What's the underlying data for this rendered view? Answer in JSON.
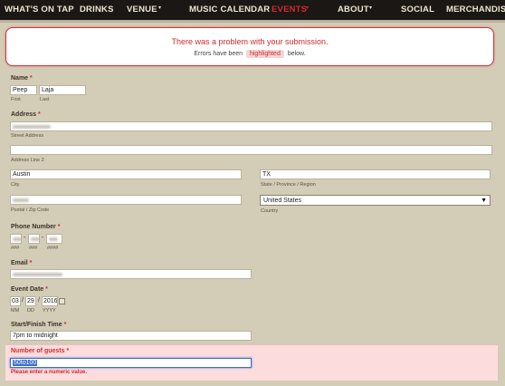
{
  "nav": {
    "items": [
      {
        "label": "What's On Tap",
        "has_menu": false,
        "active": false
      },
      {
        "label": "Drinks",
        "has_menu": false,
        "active": false
      },
      {
        "label": "Venue",
        "has_menu": true,
        "active": false
      },
      {
        "label": "Music Calendar",
        "has_menu": false,
        "active": false
      },
      {
        "label": "Events",
        "has_menu": true,
        "active": true
      },
      {
        "label": "About",
        "has_menu": true,
        "active": false
      },
      {
        "label": "Social",
        "has_menu": false,
        "active": false
      },
      {
        "label": "Merchandise",
        "has_menu": false,
        "active": false
      }
    ],
    "caret": "▾"
  },
  "error_box": {
    "title": "There was a problem with your submission.",
    "line_prefix": "Errors have been",
    "highlight": "highlighted",
    "line_suffix": "below."
  },
  "form": {
    "name": {
      "label": "Name",
      "required": "*",
      "first_value": "Peep",
      "last_value": "Laja",
      "first_sub": "First",
      "last_sub": "Last"
    },
    "address": {
      "label": "Address",
      "required": "*",
      "street_sub": "Street Address",
      "line2_sub": "Address Line 2",
      "city_value": "Austin",
      "city_sub": "City",
      "state_value": "TX",
      "state_sub": "State / Province / Region",
      "postal_sub": "Postal / Zip Code",
      "country_value": "United States",
      "country_sub": "Country"
    },
    "phone": {
      "label": "Phone Number",
      "required": "*",
      "dash": "-",
      "subs": [
        "###",
        "###",
        "####"
      ]
    },
    "email": {
      "label": "Email",
      "required": "*"
    },
    "event_date": {
      "label": "Event Date",
      "required": "*",
      "month": "03",
      "day": "29",
      "year": "2016",
      "slash": "/",
      "subs": [
        "MM",
        "DD",
        "YYYY"
      ]
    },
    "time": {
      "label": "Start/Finish Time",
      "required": "*",
      "value": "7pm to midnight"
    },
    "guests": {
      "label": "Number of guests",
      "required": "*",
      "value": "50to100",
      "error": "Please enter a numeric value."
    }
  },
  "colors": {
    "nav_bg": "#1b1714",
    "nav_text": "#eee6d2",
    "accent_red": "#cf2b32",
    "page_bg": "#d3ccb6"
  }
}
